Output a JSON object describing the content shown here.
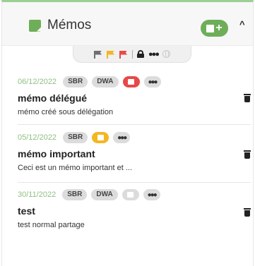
{
  "panel": {
    "title": "Mémos",
    "icon": "memo-icon",
    "add_icon": "add-memo-icon",
    "add_label": "+",
    "collapse_icon": "chevron-up-icon",
    "collapse_label": "^"
  },
  "filters": [
    {
      "name": "grey-flag-icon",
      "color": "#6e6e6e"
    },
    {
      "name": "yellow-flag-icon",
      "color": "#f3b722"
    },
    {
      "name": "red-flag-icon",
      "color": "#e84848"
    },
    {
      "name": "lock-icon"
    },
    {
      "name": "people-icon"
    },
    {
      "name": "globe-icon"
    }
  ],
  "memos": [
    {
      "date": "06/12/2022",
      "tags": [
        "SBR",
        "DWA"
      ],
      "priority": "red",
      "title": "mémo délégué",
      "description": "mémo créé sous délégation"
    },
    {
      "date": "05/12/2022",
      "tags": [
        "SBR"
      ],
      "priority": "yellow",
      "title": "mémo important",
      "description": "Ceci est un mémo important et ..."
    },
    {
      "date": "30/11/2022",
      "tags": [
        "SBR",
        "DWA"
      ],
      "priority": "none",
      "title": "test",
      "description": "test normal partage"
    }
  ],
  "colors": {
    "accent": "#6fae59",
    "date": "#8fbf82",
    "red": "#e84848",
    "yellow": "#f3b722",
    "tag_bg": "#dcdcdc"
  }
}
